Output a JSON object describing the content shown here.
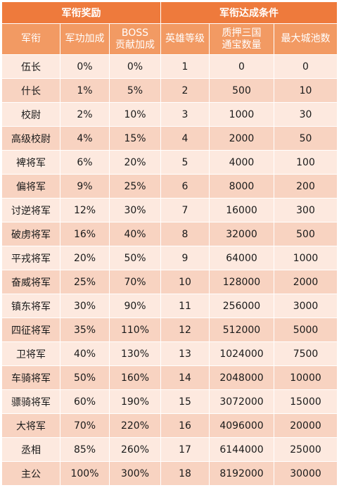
{
  "header": {
    "group_reward": "军衔奖励",
    "group_condition": "军衔达成条件",
    "col_rank": "军衔",
    "col_merit_bonus": "军功加成",
    "col_boss_bonus_line1": "BOSS",
    "col_boss_bonus_line2": "贡献加成",
    "col_hero_level": "英雄等级",
    "col_pledge_line1": "质押三国",
    "col_pledge_line2": "通宝数量",
    "col_max_cities": "最大城池数"
  },
  "rows": [
    {
      "rank": "伍长",
      "merit": "0%",
      "boss": "0%",
      "level": "1",
      "pledge": "0",
      "cities": "0"
    },
    {
      "rank": "什长",
      "merit": "1%",
      "boss": "5%",
      "level": "2",
      "pledge": "500",
      "cities": "10"
    },
    {
      "rank": "校尉",
      "merit": "2%",
      "boss": "10%",
      "level": "3",
      "pledge": "1000",
      "cities": "30"
    },
    {
      "rank": "高级校尉",
      "merit": "4%",
      "boss": "15%",
      "level": "4",
      "pledge": "2000",
      "cities": "50"
    },
    {
      "rank": "裨将军",
      "merit": "6%",
      "boss": "20%",
      "level": "5",
      "pledge": "4000",
      "cities": "100"
    },
    {
      "rank": "偏将军",
      "merit": "9%",
      "boss": "25%",
      "level": "6",
      "pledge": "8000",
      "cities": "200"
    },
    {
      "rank": "讨逆将军",
      "merit": "12%",
      "boss": "30%",
      "level": "7",
      "pledge": "16000",
      "cities": "300"
    },
    {
      "rank": "破虏将军",
      "merit": "16%",
      "boss": "40%",
      "level": "8",
      "pledge": "32000",
      "cities": "500"
    },
    {
      "rank": "平戎将军",
      "merit": "20%",
      "boss": "50%",
      "level": "9",
      "pledge": "64000",
      "cities": "1000"
    },
    {
      "rank": "奋威将军",
      "merit": "25%",
      "boss": "70%",
      "level": "10",
      "pledge": "128000",
      "cities": "2000"
    },
    {
      "rank": "镇东将军",
      "merit": "30%",
      "boss": "90%",
      "level": "11",
      "pledge": "256000",
      "cities": "3000"
    },
    {
      "rank": "四征将军",
      "merit": "35%",
      "boss": "110%",
      "level": "12",
      "pledge": "512000",
      "cities": "5000"
    },
    {
      "rank": "卫将军",
      "merit": "40%",
      "boss": "130%",
      "level": "13",
      "pledge": "1024000",
      "cities": "7500"
    },
    {
      "rank": "车骑将军",
      "merit": "50%",
      "boss": "160%",
      "level": "14",
      "pledge": "2048000",
      "cities": "10000"
    },
    {
      "rank": "骠骑将军",
      "merit": "60%",
      "boss": "190%",
      "level": "15",
      "pledge": "3072000",
      "cities": "15000"
    },
    {
      "rank": "大将军",
      "merit": "70%",
      "boss": "220%",
      "level": "16",
      "pledge": "4096000",
      "cities": "20000"
    },
    {
      "rank": "丞相",
      "merit": "85%",
      "boss": "260%",
      "level": "17",
      "pledge": "6144000",
      "cities": "25000"
    },
    {
      "rank": "主公",
      "merit": "100%",
      "boss": "300%",
      "level": "18",
      "pledge": "8192000",
      "cities": "30000"
    }
  ],
  "colors": {
    "group_header_bg": "#ee7a3c",
    "column_header_bg": "#f29a63",
    "row_light_bg": "#fde9df",
    "row_dark_bg": "#f8d3c1",
    "header_text": "#ffffff"
  }
}
